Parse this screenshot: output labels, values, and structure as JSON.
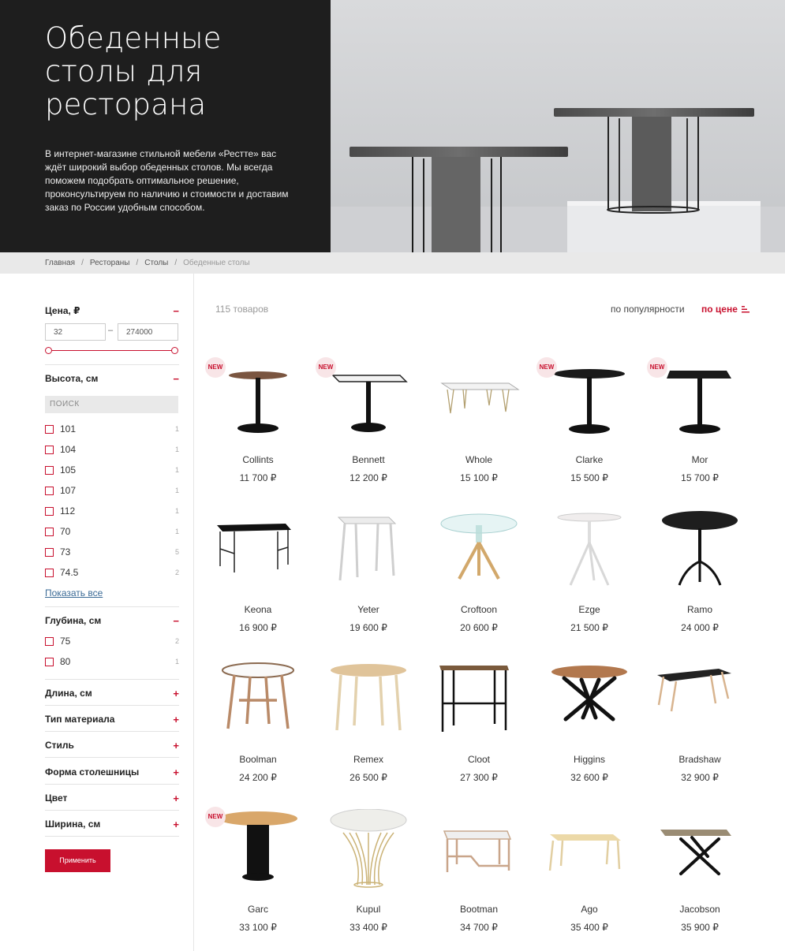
{
  "hero": {
    "title": "Обеденные столы для ресторана",
    "text": "В интернет-магазине стильной мебели «Рестте» вас ждёт широкий выбор обеденных столов. Мы всегда поможем подобрать оптимальное решение, проконсультируем по наличию и стоимости и доставим заказ по России удобным способом."
  },
  "breadcrumbs": [
    "Главная",
    "Рестораны",
    "Столы",
    "Обеденные столы"
  ],
  "breadcrumb_separator": "/",
  "filters": {
    "price": {
      "title": "Цена, ₽",
      "toggle": "−",
      "min": "32",
      "max": "274000",
      "dash": "–"
    },
    "height": {
      "title": "Высота, см",
      "toggle": "−",
      "search_placeholder": "ПОИСК",
      "options": [
        {
          "label": "101",
          "count": "1"
        },
        {
          "label": "104",
          "count": "1"
        },
        {
          "label": "105",
          "count": "1"
        },
        {
          "label": "107",
          "count": "1"
        },
        {
          "label": "112",
          "count": "1"
        },
        {
          "label": "70",
          "count": "1"
        },
        {
          "label": "73",
          "count": "5"
        },
        {
          "label": "74.5",
          "count": "2"
        }
      ],
      "show_all": "Показать все"
    },
    "depth": {
      "title": "Глубина, см",
      "toggle": "−",
      "options": [
        {
          "label": "75",
          "count": "2"
        },
        {
          "label": "80",
          "count": "1"
        }
      ]
    },
    "collapsed": [
      {
        "title": "Длина, см",
        "toggle": "+"
      },
      {
        "title": "Тип материала",
        "toggle": "+"
      },
      {
        "title": "Стиль",
        "toggle": "+"
      },
      {
        "title": "Форма столешницы",
        "toggle": "+"
      },
      {
        "title": "Цвет",
        "toggle": "+"
      },
      {
        "title": "Ширина, см",
        "toggle": "+"
      }
    ],
    "apply_label": "Применить"
  },
  "listing": {
    "count": "115 товаров",
    "sort_popularity": "по популярности",
    "sort_price": "по цене",
    "badge_label": "NEW",
    "products": [
      {
        "name": "Collints",
        "price": "11 700 ₽",
        "is_new": true,
        "icon": "pedestal-round-wood-table"
      },
      {
        "name": "Bennett",
        "price": "12 200 ₽",
        "is_new": true,
        "icon": "pedestal-square-white-table"
      },
      {
        "name": "Whole",
        "price": "15 100 ₽",
        "is_new": false,
        "icon": "hairpin-leg-table"
      },
      {
        "name": "Clarke",
        "price": "15 500 ₽",
        "is_new": true,
        "icon": "pedestal-round-black-table"
      },
      {
        "name": "Mor",
        "price": "15 700 ₽",
        "is_new": true,
        "icon": "pedestal-square-black-table"
      },
      {
        "name": "Keona",
        "price": "16 900 ₽",
        "is_new": false,
        "icon": "metal-frame-desk"
      },
      {
        "name": "Yeter",
        "price": "19 600 ₽",
        "is_new": false,
        "icon": "square-four-leg-table"
      },
      {
        "name": "Croftoon",
        "price": "20 600 ₽",
        "is_new": false,
        "icon": "glass-top-table"
      },
      {
        "name": "Ezge",
        "price": "21 500 ₽",
        "is_new": false,
        "icon": "tripod-white-table"
      },
      {
        "name": "Ramo",
        "price": "24 000 ₽",
        "is_new": false,
        "icon": "round-black-spider-table"
      },
      {
        "name": "Boolman",
        "price": "24 200 ₽",
        "is_new": false,
        "icon": "round-white-wood-leg-table"
      },
      {
        "name": "Remex",
        "price": "26 500 ₽",
        "is_new": false,
        "icon": "round-oak-table"
      },
      {
        "name": "Cloot",
        "price": "27 300 ₽",
        "is_new": false,
        "icon": "bar-height-table"
      },
      {
        "name": "Higgins",
        "price": "32 600 ₽",
        "is_new": false,
        "icon": "cross-leg-round-table"
      },
      {
        "name": "Bradshaw",
        "price": "32 900 ₽",
        "is_new": false,
        "icon": "rectangular-black-top-table"
      },
      {
        "name": "Garc",
        "price": "33 100 ₽",
        "is_new": true,
        "icon": "cylinder-base-table"
      },
      {
        "name": "Kupul",
        "price": "33 400 ₽",
        "is_new": false,
        "icon": "marble-wire-base-table"
      },
      {
        "name": "Bootman",
        "price": "34 700 ₽",
        "is_new": false,
        "icon": "sled-base-table"
      },
      {
        "name": "Ago",
        "price": "35 400 ₽",
        "is_new": false,
        "icon": "light-rectangular-table"
      },
      {
        "name": "Jacobson",
        "price": "35 900 ₽",
        "is_new": false,
        "icon": "x-base-rectangular-table"
      }
    ]
  },
  "colors": {
    "accent": "#c8102e",
    "hero_dark": "#1e1e1e",
    "breadcrumb_bg": "#e9e9e9",
    "badge_bg": "#f8e5e7"
  }
}
